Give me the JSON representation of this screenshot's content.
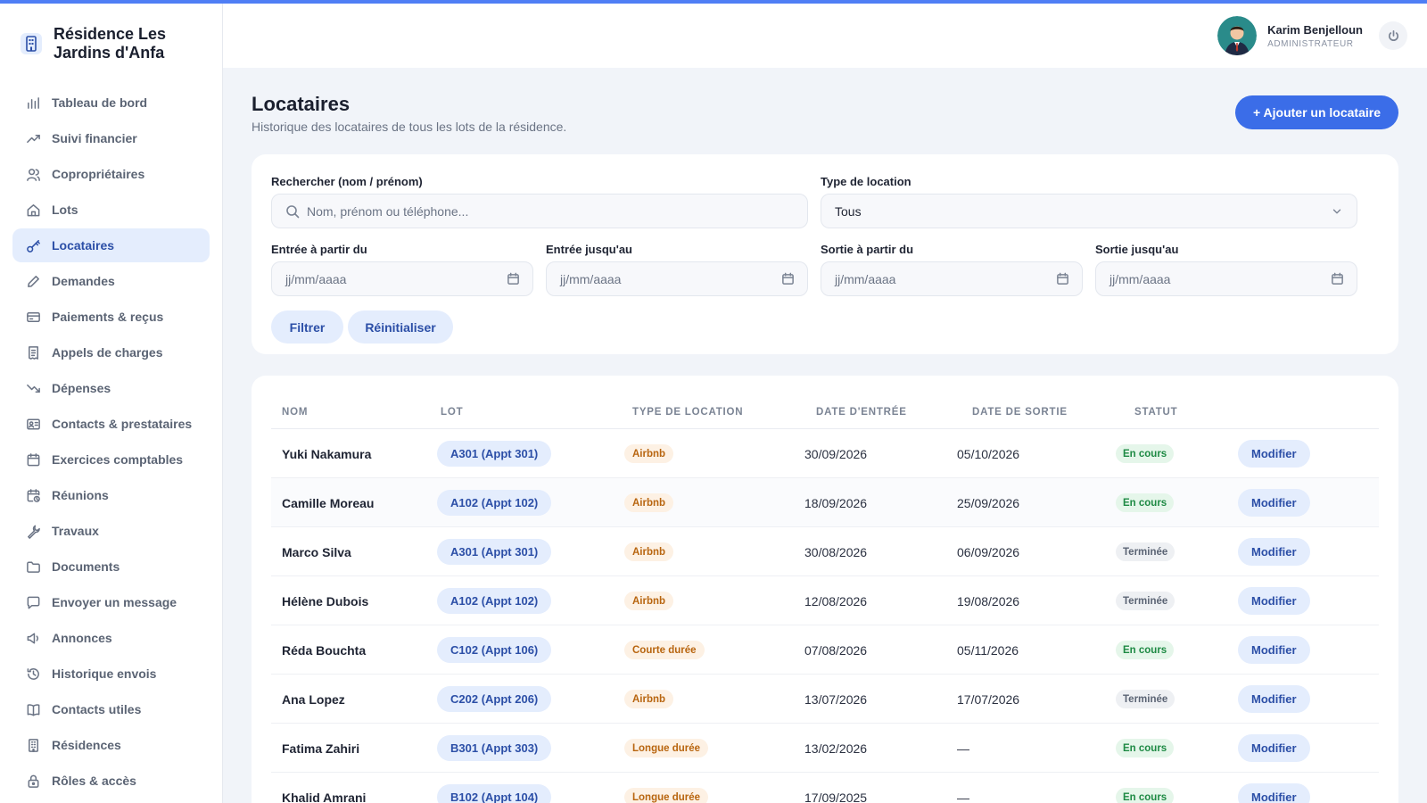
{
  "brand": {
    "name": "Résidence Les Jardins d'Anfa"
  },
  "sidebar": {
    "items": [
      {
        "label": "Tableau de bord",
        "icon": "bar-chart-icon"
      },
      {
        "label": "Suivi financier",
        "icon": "trending-up-icon"
      },
      {
        "label": "Copropriétaires",
        "icon": "users-icon"
      },
      {
        "label": "Lots",
        "icon": "home-icon"
      },
      {
        "label": "Locataires",
        "icon": "key-icon",
        "active": true
      },
      {
        "label": "Demandes",
        "icon": "pencil-icon"
      },
      {
        "label": "Paiements & reçus",
        "icon": "credit-card-icon"
      },
      {
        "label": "Appels de charges",
        "icon": "receipt-icon"
      },
      {
        "label": "Dépenses",
        "icon": "trending-down-icon"
      },
      {
        "label": "Contacts & prestataires",
        "icon": "contact-card-icon"
      },
      {
        "label": "Exercices comptables",
        "icon": "calendar-icon"
      },
      {
        "label": "Réunions",
        "icon": "calendar-clock-icon"
      },
      {
        "label": "Travaux",
        "icon": "wrench-icon"
      },
      {
        "label": "Documents",
        "icon": "folder-icon"
      },
      {
        "label": "Envoyer un message",
        "icon": "message-icon"
      },
      {
        "label": "Annonces",
        "icon": "megaphone-icon"
      },
      {
        "label": "Historique envois",
        "icon": "history-icon"
      },
      {
        "label": "Contacts utiles",
        "icon": "book-icon"
      },
      {
        "label": "Résidences",
        "icon": "building-icon"
      },
      {
        "label": "Rôles & accès",
        "icon": "lock-icon"
      }
    ]
  },
  "header": {
    "user_name": "Karim Benjelloun",
    "user_role": "ADMINISTRATEUR"
  },
  "page": {
    "title": "Locataires",
    "subtitle": "Historique des locataires de tous les lots de la résidence.",
    "add_button": "+ Ajouter un locataire"
  },
  "filters": {
    "search_label": "Rechercher (nom / prénom)",
    "search_placeholder": "Nom, prénom ou téléphone...",
    "type_label": "Type de location",
    "type_value": "Tous",
    "entry_from_label": "Entrée à partir du",
    "entry_to_label": "Entrée jusqu'au",
    "exit_from_label": "Sortie à partir du",
    "exit_to_label": "Sortie jusqu'au",
    "date_placeholder": "jj/mm/aaaa",
    "filter_button": "Filtrer",
    "reset_button": "Réinitialiser"
  },
  "table": {
    "columns": [
      "NOM",
      "LOT",
      "TYPE DE LOCATION",
      "DATE D'ENTRÉE",
      "DATE DE SORTIE",
      "STATUT"
    ],
    "edit_label": "Modifier",
    "rows": [
      {
        "name": "Yuki Nakamura",
        "lot": "A301 (Appt 301)",
        "type": "Airbnb",
        "entry": "30/09/2026",
        "exit": "05/10/2026",
        "status": "En cours"
      },
      {
        "name": "Camille Moreau",
        "lot": "A102 (Appt 102)",
        "type": "Airbnb",
        "entry": "18/09/2026",
        "exit": "25/09/2026",
        "status": "En cours"
      },
      {
        "name": "Marco Silva",
        "lot": "A301 (Appt 301)",
        "type": "Airbnb",
        "entry": "30/08/2026",
        "exit": "06/09/2026",
        "status": "Terminée"
      },
      {
        "name": "Hélène Dubois",
        "lot": "A102 (Appt 102)",
        "type": "Airbnb",
        "entry": "12/08/2026",
        "exit": "19/08/2026",
        "status": "Terminée"
      },
      {
        "name": "Réda Bouchta",
        "lot": "C102 (Appt 106)",
        "type": "Courte durée",
        "entry": "07/08/2026",
        "exit": "05/11/2026",
        "status": "En cours"
      },
      {
        "name": "Ana Lopez",
        "lot": "C202 (Appt 206)",
        "type": "Airbnb",
        "entry": "13/07/2026",
        "exit": "17/07/2026",
        "status": "Terminée"
      },
      {
        "name": "Fatima Zahiri",
        "lot": "B301 (Appt 303)",
        "type": "Longue durée",
        "entry": "13/02/2026",
        "exit": "—",
        "status": "En cours"
      },
      {
        "name": "Khalid Amrani",
        "lot": "B102 (Appt 104)",
        "type": "Longue durée",
        "entry": "17/09/2025",
        "exit": "—",
        "status": "En cours"
      }
    ]
  },
  "colors": {
    "accent": "#3b6de8",
    "pill_bg": "#e4edfd",
    "pill_text": "#2c4fa7"
  }
}
